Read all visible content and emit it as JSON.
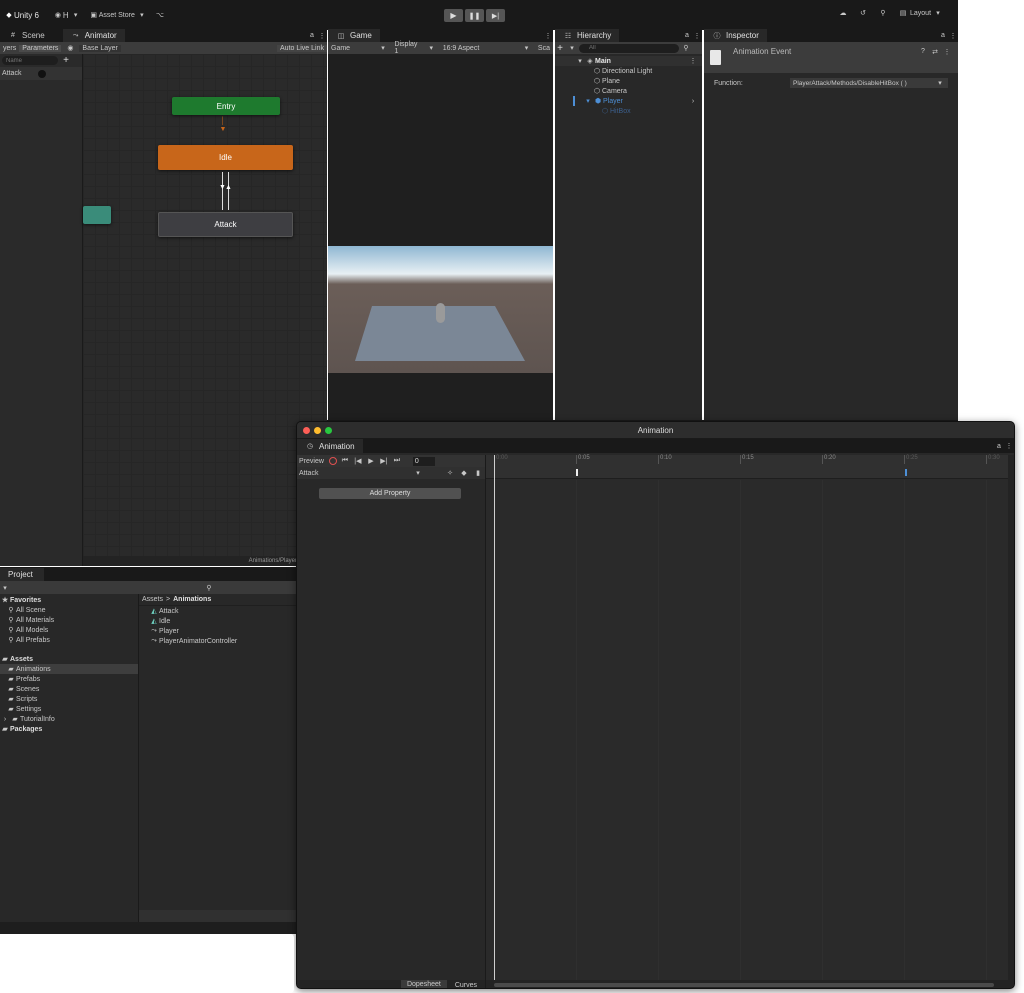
{
  "topbar": {
    "app_title": "Unity 6",
    "account": "H",
    "asset_store": "Asset Store",
    "layout": "Layout"
  },
  "animator_panel": {
    "tabs": [
      "Scene",
      "Animator"
    ],
    "sub_tabs": [
      "yers",
      "Parameters"
    ],
    "layer_name": "Base Layer",
    "auto_live_link": "Auto Live Link",
    "search_placeholder": "Name",
    "parameter": "Attack",
    "nodes": {
      "entry": "Entry",
      "idle": "Idle",
      "attack": "Attack"
    },
    "footer_path": "Animations/Player"
  },
  "game_panel": {
    "tab": "Game",
    "view_select": "Game",
    "display": "Display 1",
    "aspect": "16:9 Aspect",
    "scale": "Sca"
  },
  "hierarchy": {
    "tab": "Hierarchy",
    "search_placeholder": "All",
    "scene": "Main",
    "items": [
      "Directional Light",
      "Plane",
      "Camera",
      "Player",
      "HitBox"
    ]
  },
  "inspector": {
    "tab": "Inspector",
    "title": "Animation Event",
    "function_label": "Function:",
    "function_value": "PlayerAttack/Methods/DisableHitBox ( )"
  },
  "project": {
    "tab": "Project",
    "favorites_label": "Favorites",
    "favorites": [
      "All Scene",
      "All Materials",
      "All Models",
      "All Prefabs"
    ],
    "assets_label": "Assets",
    "asset_folders": [
      "Animations",
      "Prefabs",
      "Scenes",
      "Scripts",
      "Settings",
      "TutorialInfo"
    ],
    "packages_label": "Packages",
    "breadcrumb_root": "Assets",
    "breadcrumb_current": "Animations",
    "files": [
      "Attack",
      "Idle",
      "Player",
      "PlayerAnimatorController"
    ]
  },
  "animation_window": {
    "title": "Animation",
    "tab": "Animation",
    "preview_label": "Preview",
    "frame_value": "0",
    "clip": "Attack",
    "add_property": "Add Property",
    "ruler": [
      "0:00",
      "0:05",
      "0:10",
      "0:15",
      "0:20",
      "0:25",
      "0:30"
    ],
    "bottom_tabs": [
      "Dopesheet",
      "Curves"
    ]
  },
  "colors": {
    "entry_node": "#1e7a2e",
    "idle_node": "#c8661a",
    "attack_node": "#3e3e42",
    "teal_node": "#3a8c7a",
    "selected_blue": "#4d8fd6"
  }
}
